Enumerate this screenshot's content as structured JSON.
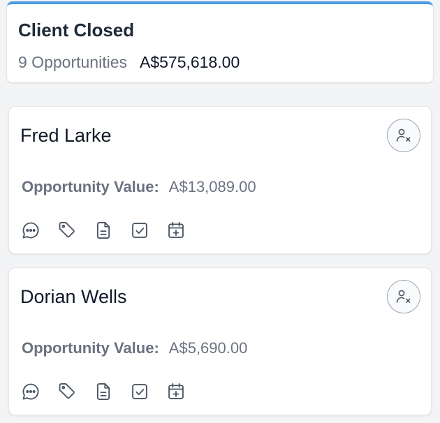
{
  "stage": {
    "title": "Client Closed",
    "count_label": "9 Opportunities",
    "total": "A$575,618.00",
    "accent_color": "#4a9be3"
  },
  "cards": [
    {
      "name": "Fred Larke",
      "value_label": "Opportunity Value:",
      "value": "A$13,089.00",
      "avatar_icon": "user-x-icon",
      "actions": [
        "chat-icon",
        "tag-icon",
        "document-icon",
        "checkbox-icon",
        "calendar-plus-icon"
      ]
    },
    {
      "name": "Dorian Wells",
      "value_label": "Opportunity Value:",
      "value": "A$5,690.00",
      "avatar_icon": "user-x-icon",
      "actions": [
        "chat-icon",
        "tag-icon",
        "document-icon",
        "checkbox-icon",
        "calendar-plus-icon"
      ]
    }
  ]
}
